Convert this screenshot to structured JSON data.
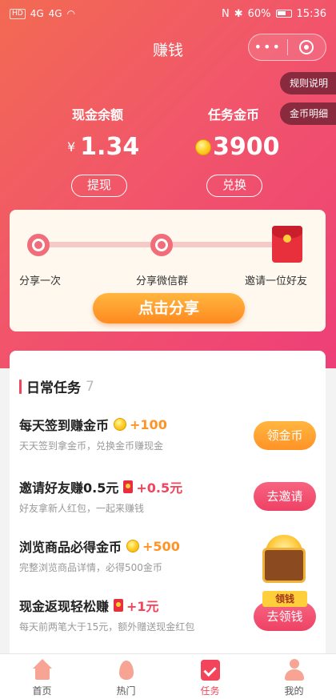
{
  "status_bar": {
    "left_chips": [
      "HD",
      "4G",
      "4G"
    ],
    "battery": "60%",
    "time": "15:36"
  },
  "nav": {
    "title": "赚钱",
    "more": "•••"
  },
  "side_tags": {
    "rules": "规则说明",
    "coin_detail": "金币明细"
  },
  "balance": {
    "cash_label": "现金余额",
    "currency": "¥",
    "cash_value": "1.34",
    "withdraw_button": "提现",
    "coin_label": "任务金币",
    "coin_value": "3900",
    "exchange_button": "兑换"
  },
  "share": {
    "steps": [
      {
        "label": "分享一次"
      },
      {
        "label": "分享微信群"
      },
      {
        "label": "邀请一位好友"
      }
    ],
    "button": "点击分享"
  },
  "tasks": {
    "title": "日常任务",
    "count": "7",
    "items": [
      {
        "title": "每天签到赚金币",
        "reward": "+100",
        "reward_icon": "coin-icon",
        "desc": "天天签到拿金币，兑换金币赚现金",
        "button": "领金币"
      },
      {
        "title": "邀请好友赚0.5元",
        "reward": "+0.5元",
        "reward_icon": "redpack-icon",
        "desc": "好友拿新人红包，一起来赚钱",
        "button": "去邀请"
      },
      {
        "title": "浏览商品必得金币",
        "reward": "+500",
        "reward_icon": "coin-icon",
        "desc": "完整浏览商品详情，必得500金币",
        "button": "领钱"
      },
      {
        "title": "现金返现轻松赚",
        "reward": "+1元",
        "reward_icon": "redpack-icon",
        "desc": "每天前两笔大于15元，额外赠送现金红包",
        "button": "去领钱"
      }
    ]
  },
  "tabbar": [
    {
      "label": "首页",
      "icon": "home-icon"
    },
    {
      "label": "热门",
      "icon": "fire-icon"
    },
    {
      "label": "任务",
      "icon": "task-icon",
      "active": true
    },
    {
      "label": "我的",
      "icon": "profile-icon"
    }
  ],
  "colors": {
    "brand_red": "#f2445a",
    "orange": "#ff9326",
    "gradient_start": "#f26a52",
    "gradient_end": "#ee3f78"
  }
}
